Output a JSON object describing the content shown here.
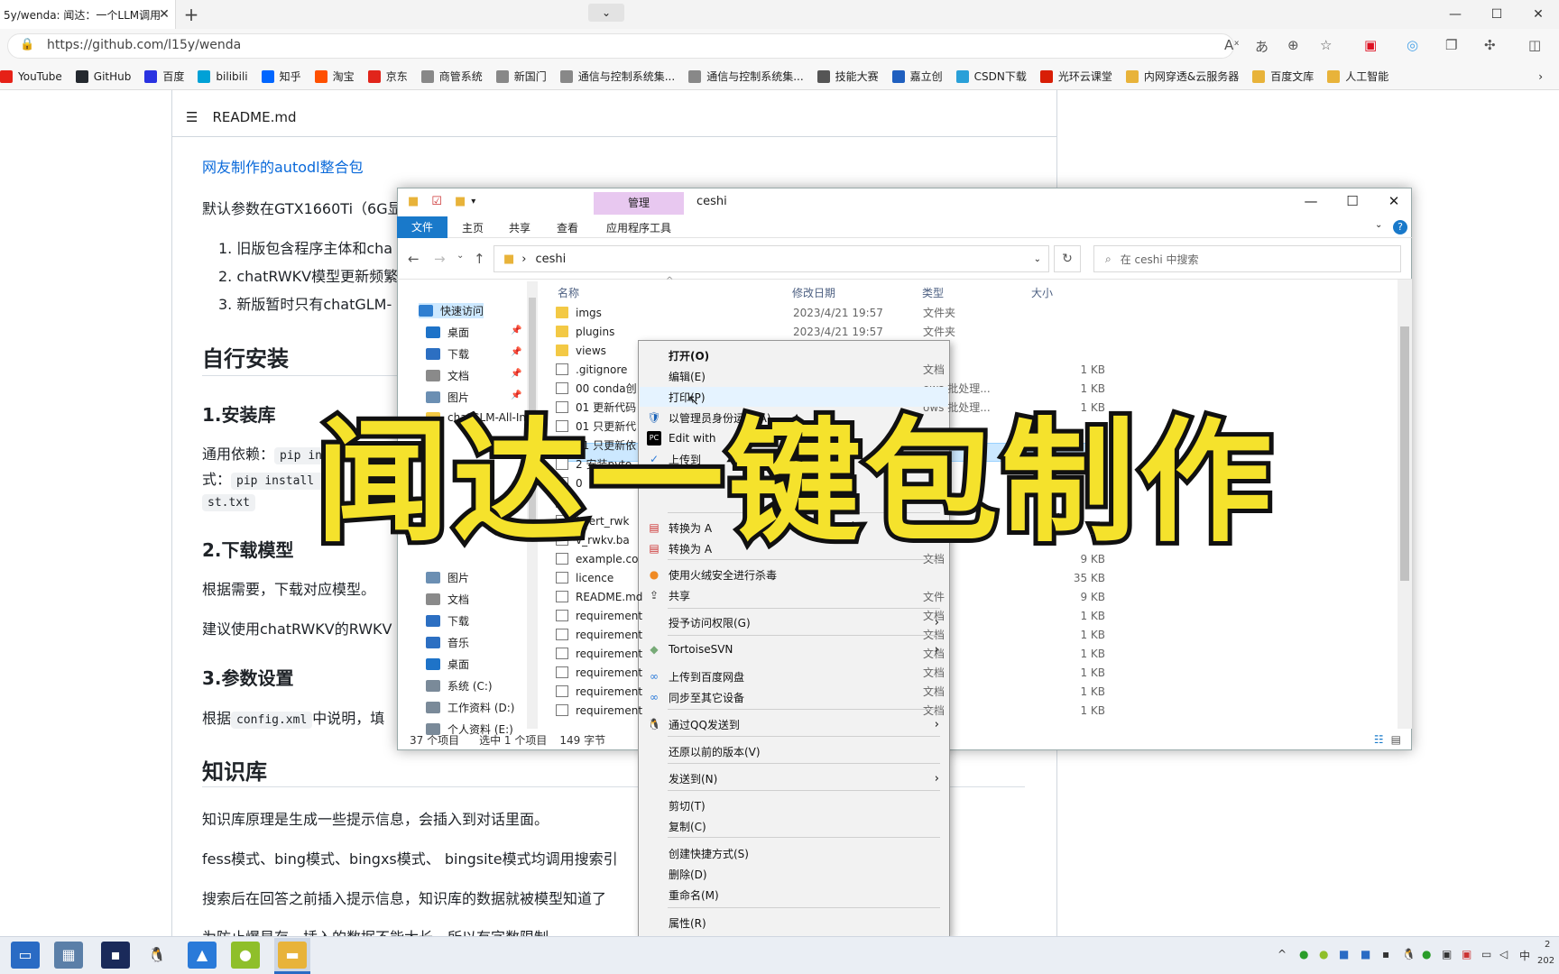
{
  "browser": {
    "tab_title": "5y/wenda: 闻达：一个LLM调用",
    "tab_close": "✕",
    "new_tab": "+",
    "tab_menu": "⌄",
    "url": "https://github.com/l15y/wenda",
    "win_min": "—",
    "win_max": "☐",
    "win_close": "✕",
    "bookmarks": [
      {
        "label": "YouTube",
        "color": "#e62117"
      },
      {
        "label": "GitHub",
        "color": "#24292f"
      },
      {
        "label": "百度",
        "color": "#2932e1"
      },
      {
        "label": "bilibili",
        "color": "#00a1d6"
      },
      {
        "label": "知乎",
        "color": "#0066ff"
      },
      {
        "label": "淘宝",
        "color": "#ff5000"
      },
      {
        "label": "京东",
        "color": "#e1251b"
      },
      {
        "label": "商管系统",
        "color": "#888888"
      },
      {
        "label": "新国门",
        "color": "#888888"
      },
      {
        "label": "通信与控制系统集...",
        "color": "#888888"
      },
      {
        "label": "通信与控制系统集...",
        "color": "#888888"
      },
      {
        "label": "技能大赛",
        "color": "#555555"
      },
      {
        "label": "嘉立创",
        "color": "#1f5fbf"
      },
      {
        "label": "CSDN下载",
        "color": "#2aa0d8"
      },
      {
        "label": "光环云课堂",
        "color": "#d81e06"
      },
      {
        "label": "内网穿透&云服务器",
        "color": "#e8b33a"
      },
      {
        "label": "百度文库",
        "color": "#e8b33a"
      },
      {
        "label": "人工智能",
        "color": "#e8b33a"
      }
    ]
  },
  "readme": {
    "header": "README.md",
    "link": "网友制作的autodl整合包",
    "para1": "默认参数在GTX1660Ti（6G显",
    "list": [
      "1. 旧版包含程序主体和cha",
      "2. chatRWKV模型更新频繁",
      "3. 新版暂时只有chatGLM-"
    ],
    "h_install": "自行安装",
    "h_lib": "1.安装库",
    "deps_prefix": "通用依赖：",
    "deps_code1": "pip ins",
    "deps_line2_prefix": "式：",
    "deps_code2": "pip install -",
    "deps_code3": "st.txt",
    "h_model": "2.下载模型",
    "model_text": "根据需要，下载对应模型。",
    "model_text2": "建议使用chatRWKV的RWKV",
    "h_param": "3.参数设置",
    "param_prefix": "根据",
    "param_code": "config.xml",
    "param_suffix": "中说明，填",
    "h_kb": "知识库",
    "kb1": "知识库原理是生成一些提示信息，会插入到对话里面。",
    "kb2": "fess模式、bing模式、bingxs模式、 bingsite模式均调用搜索引",
    "kb3": "搜索后在回答之前插入提示信息，知识库的数据就被模型知道了",
    "kb4": "为防止爆显存，插入的数据不能太长，所以有字数限制"
  },
  "explorer": {
    "manage_tab": "管理",
    "folder_name": "ceshi",
    "ribbon": {
      "file": "文件",
      "home": "主页",
      "share": "共享",
      "view": "查看",
      "app_tools": "应用程序工具"
    },
    "path": "ceshi",
    "search_placeholder": "在 ceshi 中搜索",
    "columns": {
      "name": "名称",
      "date": "修改日期",
      "type": "类型",
      "size": "大小"
    },
    "sidebar": [
      {
        "label": "快速访问",
        "color": "#2f7fd1",
        "pin": ""
      },
      {
        "label": "桌面",
        "color": "#1e73c8",
        "pin": "📌"
      },
      {
        "label": "下载",
        "color": "#2c6fc2",
        "pin": "📌"
      },
      {
        "label": "文档",
        "color": "#8a8a8a",
        "pin": "📌"
      },
      {
        "label": "图片",
        "color": "#6b8fb3",
        "pin": "📌"
      },
      {
        "label": "chatGLM-All-In",
        "color": "#f3c945",
        "pin": ""
      },
      {
        "label": "图片",
        "color": "#6b8fb3",
        "pin": ""
      },
      {
        "label": "文档",
        "color": "#8a8a8a",
        "pin": ""
      },
      {
        "label": "下载",
        "color": "#2c6fc2",
        "pin": ""
      },
      {
        "label": "音乐",
        "color": "#2c6fc2",
        "pin": ""
      },
      {
        "label": "桌面",
        "color": "#1e73c8",
        "pin": ""
      },
      {
        "label": "系统 (C:)",
        "color": "#7a8a99",
        "pin": ""
      },
      {
        "label": "工作资料 (D:)",
        "color": "#7a8a99",
        "pin": ""
      },
      {
        "label": "个人资料 (E:)",
        "color": "#7a8a99",
        "pin": ""
      }
    ],
    "files": [
      {
        "name": "imgs",
        "date": "2023/4/21 19:57",
        "type": "文件夹",
        "size": "",
        "kind": "folder"
      },
      {
        "name": "plugins",
        "date": "2023/4/21 19:57",
        "type": "文件夹",
        "size": "",
        "kind": "folder"
      },
      {
        "name": "views",
        "date": "",
        "type": "",
        "size": "",
        "kind": "folder"
      },
      {
        "name": ".gitignore",
        "date": "",
        "type": "文档",
        "size": "1 KB",
        "kind": "file"
      },
      {
        "name": "00 conda创",
        "date": "",
        "type": "ows 批处理...",
        "size": "1 KB",
        "kind": "file"
      },
      {
        "name": "01 更新代码",
        "date": "",
        "type": "ows 批处理...",
        "size": "1 KB",
        "kind": "file"
      },
      {
        "name": "01 只更新代",
        "date": "",
        "type": "",
        "size": "",
        "kind": "file"
      },
      {
        "name": "01 只更新依",
        "date": "",
        "type": "",
        "size": "",
        "kind": "file"
      },
      {
        "name": "2 安装pyto",
        "date": "",
        "type": "",
        "size": "",
        "kind": "file"
      },
      {
        "name": "0",
        "date": "",
        "type": "",
        "size": "",
        "kind": "file"
      },
      {
        "name": "",
        "date": "",
        "type": "",
        "size": "",
        "kind": "file"
      },
      {
        "name": "nvert_rwk",
        "date": "",
        "type": "",
        "size": "",
        "kind": "file"
      },
      {
        "name": "v_rwkv.ba",
        "date": "",
        "type": "",
        "size": "",
        "kind": "file"
      },
      {
        "name": "example.co",
        "date": "",
        "type": "文档",
        "size": "9 KB",
        "kind": "file"
      },
      {
        "name": "licence",
        "date": "",
        "type": "",
        "size": "35 KB",
        "kind": "file"
      },
      {
        "name": "README.md",
        "date": "",
        "type": "文件",
        "size": "9 KB",
        "kind": "file"
      },
      {
        "name": "requirement",
        "date": "",
        "type": "文档",
        "size": "1 KB",
        "kind": "file"
      },
      {
        "name": "requirement",
        "date": "",
        "type": "文档",
        "size": "1 KB",
        "kind": "file"
      },
      {
        "name": "requirement",
        "date": "",
        "type": "文档",
        "size": "1 KB",
        "kind": "file"
      },
      {
        "name": "requirement",
        "date": "",
        "type": "文档",
        "size": "1 KB",
        "kind": "file"
      },
      {
        "name": "requirement",
        "date": "",
        "type": "文档",
        "size": "1 KB",
        "kind": "file"
      },
      {
        "name": "requirement",
        "date": "",
        "type": "文档",
        "size": "1 KB",
        "kind": "file"
      }
    ],
    "status_count": "37 个项目",
    "status_selected": "选中 1 个项目",
    "status_size": "149 字节"
  },
  "context_menu": {
    "items": [
      {
        "label": "打开(O)",
        "bold": true,
        "icon": "",
        "arrow": false
      },
      {
        "label": "编辑(E)",
        "icon": "",
        "arrow": false
      },
      {
        "label": "打印(P)",
        "icon": "",
        "arrow": false
      },
      {
        "label": "以管理员身份运行(A)",
        "icon": "shield",
        "arrow": false
      },
      {
        "label": "Edit with",
        "icon": "pc",
        "arrow": false
      },
      {
        "label": "上传到",
        "icon": "upload",
        "arrow": false
      },
      {
        "label": "转换为 A",
        "icon": "pdf",
        "arrow": false
      },
      {
        "label": "转换为 A",
        "icon": "pdf",
        "arrow": false
      },
      {
        "label": "使用火绒安全进行杀毒",
        "icon": "huorong",
        "arrow": false
      },
      {
        "label": "共享",
        "icon": "share",
        "arrow": false
      },
      {
        "label": "授予访问权限(G)",
        "icon": "",
        "arrow": true
      },
      {
        "label": "TortoiseSVN",
        "icon": "svn",
        "arrow": true
      },
      {
        "label": "上传到百度网盘",
        "icon": "baidu",
        "arrow": false
      },
      {
        "label": "同步至其它设备",
        "icon": "baidu",
        "arrow": false
      },
      {
        "label": "通过QQ发送到",
        "icon": "qq",
        "arrow": true
      },
      {
        "label": "还原以前的版本(V)",
        "icon": "",
        "arrow": false
      },
      {
        "label": "发送到(N)",
        "icon": "",
        "arrow": true
      },
      {
        "label": "剪切(T)",
        "icon": "",
        "arrow": false
      },
      {
        "label": "复制(C)",
        "icon": "",
        "arrow": false
      },
      {
        "label": "创建快捷方式(S)",
        "icon": "",
        "arrow": false
      },
      {
        "label": "删除(D)",
        "icon": "",
        "arrow": false
      },
      {
        "label": "重命名(M)",
        "icon": "",
        "arrow": false
      },
      {
        "label": "属性(R)",
        "icon": "",
        "arrow": false
      }
    ]
  },
  "overlay_title": "闻达一键包制作",
  "taskbar": {
    "clock_top": "2",
    "clock_bottom": "202",
    "ime": "中"
  }
}
